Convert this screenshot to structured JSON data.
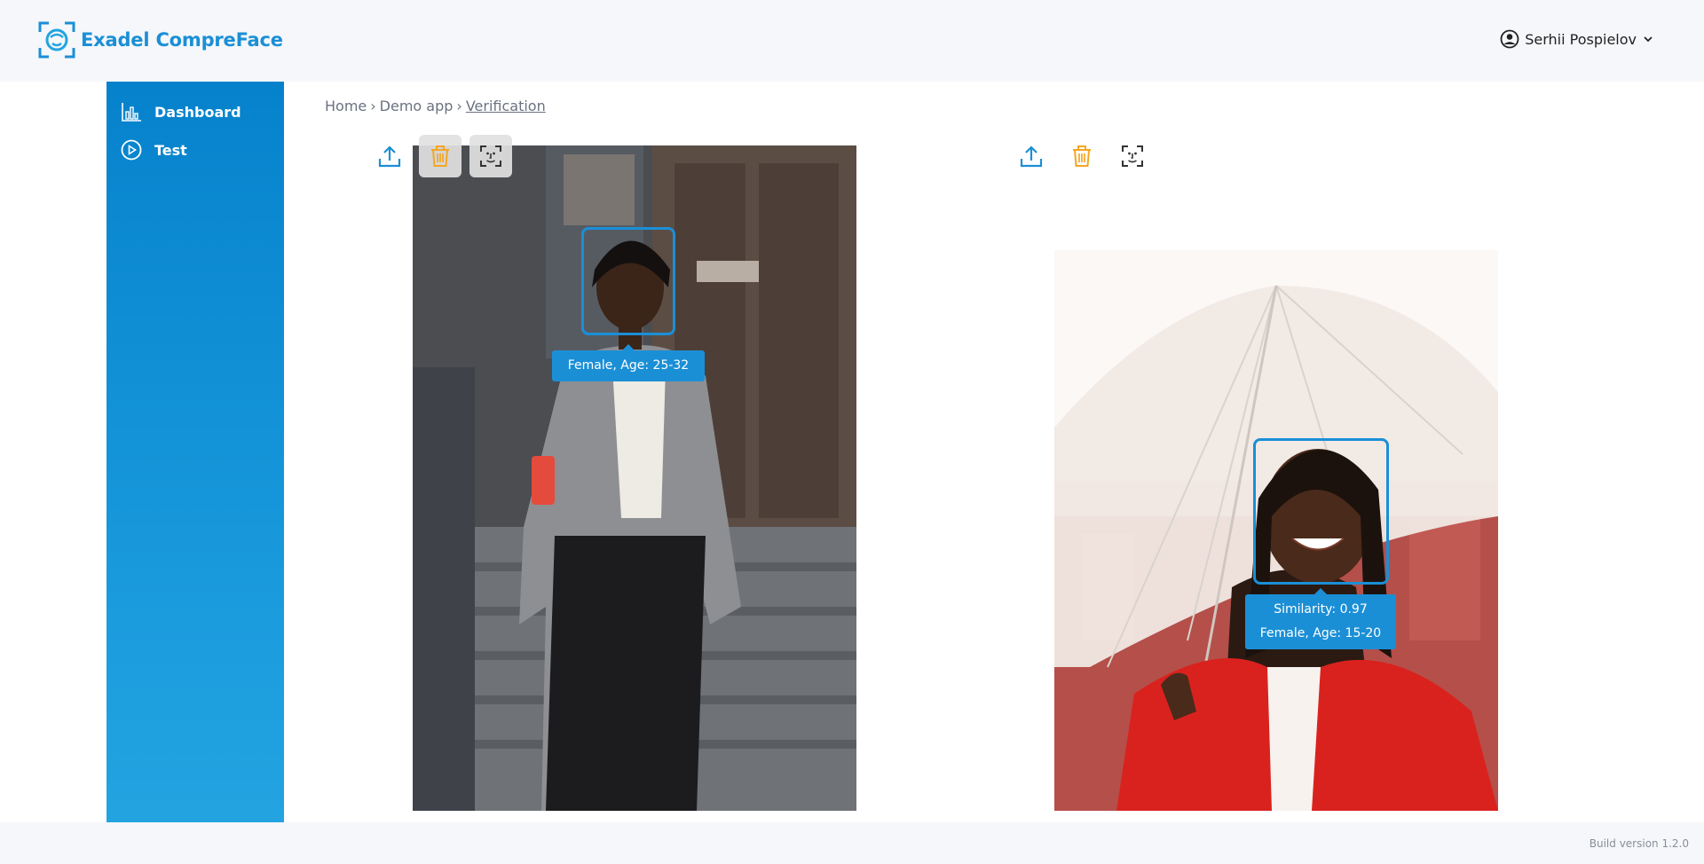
{
  "header": {
    "logo_text": "Exadel CompreFace",
    "user_name": "Serhii Pospielov",
    "icons": {
      "logo": "face-frame-icon",
      "user": "account-circle-icon",
      "menu": "chevron-down-icon"
    }
  },
  "sidebar": {
    "items": [
      {
        "label": "Dashboard",
        "icon": "bar-chart-icon"
      },
      {
        "label": "Test",
        "icon": "play-circle-icon"
      }
    ]
  },
  "breadcrumb": {
    "items": [
      "Home",
      "Demo app",
      "Verification"
    ],
    "separator": "›"
  },
  "panes": {
    "source": {
      "tools": [
        "upload-icon",
        "trash-icon",
        "face-scan-icon"
      ],
      "face_label": "Female, Age: 25-32"
    },
    "target": {
      "tools": [
        "upload-icon",
        "trash-icon",
        "face-scan-icon"
      ],
      "similarity_label": "Similarity: 0.97",
      "face_label": "Female, Age: 15-20"
    }
  },
  "footer": {
    "build_version": "Build version 1.2.0"
  },
  "colors": {
    "accent": "#1b8fd6",
    "trash": "#f5a623",
    "sidebar": "#0682cc"
  }
}
